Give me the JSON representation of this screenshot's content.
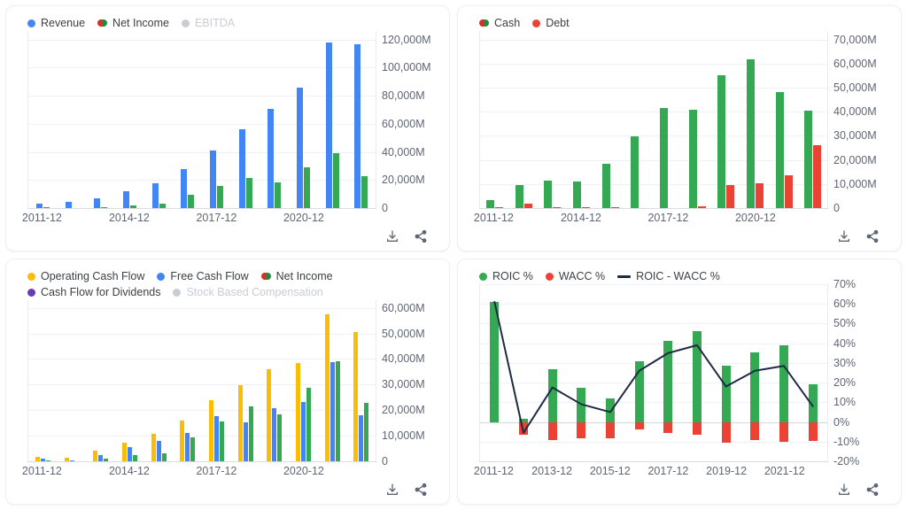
{
  "colors": {
    "revenue_blue": "#4285F4",
    "net_income_green": "#34A853",
    "cash_green": "#34A853",
    "debt_red": "#EA4335",
    "operating_cash_flow_yellow": "#FBBC04",
    "free_cash_flow_blue": "#4285F4",
    "dividends_purple": "#673AB7",
    "disabled_gray": "#C8CDD4",
    "roic_wacc_line": "#1F2A44"
  },
  "panels": [
    {
      "id": "income-statement",
      "legend": [
        {
          "label": "Revenue",
          "marker": "dot",
          "color": "#4285F4",
          "disabled": false
        },
        {
          "label": "Net Income",
          "marker": "dual-dot",
          "color": "#34A853",
          "disabled": false
        },
        {
          "label": "EBITDA",
          "marker": "dot",
          "color": "#C8CDD4",
          "disabled": true
        }
      ],
      "actions": [
        {
          "label": "Download",
          "icon": "download-icon"
        },
        {
          "label": "Share",
          "icon": "share-icon"
        }
      ]
    },
    {
      "id": "balance-sheet",
      "legend": [
        {
          "label": "Cash",
          "marker": "dual-dot",
          "color": "#34A853",
          "disabled": false
        },
        {
          "label": "Debt",
          "marker": "dot",
          "color": "#EA4335",
          "disabled": false
        }
      ],
      "actions": [
        {
          "label": "Download",
          "icon": "download-icon"
        },
        {
          "label": "Share",
          "icon": "share-icon"
        }
      ]
    },
    {
      "id": "cash-flow",
      "legend": [
        {
          "label": "Operating Cash Flow",
          "marker": "dot",
          "color": "#FBBC04",
          "disabled": false
        },
        {
          "label": "Free Cash Flow",
          "marker": "dot",
          "color": "#4285F4",
          "disabled": false
        },
        {
          "label": "Net Income",
          "marker": "dual-dot",
          "color": "#34A853",
          "disabled": false
        },
        {
          "label": "Cash Flow for Dividends",
          "marker": "dot",
          "color": "#673AB7",
          "disabled": false
        },
        {
          "label": "Stock Based Compensation",
          "marker": "dot",
          "color": "#C8CDD4",
          "disabled": true
        }
      ],
      "actions": [
        {
          "label": "Download",
          "icon": "download-icon"
        },
        {
          "label": "Share",
          "icon": "share-icon"
        }
      ]
    },
    {
      "id": "roic-wacc",
      "legend": [
        {
          "label": "ROIC %",
          "marker": "dot",
          "color": "#34A853",
          "disabled": false
        },
        {
          "label": "WACC %",
          "marker": "dot",
          "color": "#EA4335",
          "disabled": false
        },
        {
          "label": "ROIC - WACC %",
          "marker": "line",
          "color": "#1F2A44",
          "disabled": false
        }
      ],
      "actions": [
        {
          "label": "Download",
          "icon": "download-icon"
        },
        {
          "label": "Share",
          "icon": "share-icon"
        }
      ]
    }
  ],
  "chart_data": [
    {
      "type": "bar",
      "id": "income-statement",
      "title": "",
      "xlabel": "",
      "ylabel": "",
      "grid": true,
      "legend_position": "top-left",
      "categories": [
        "2011-12",
        "2012-12",
        "2013-12",
        "2014-12",
        "2015-12",
        "2016-12",
        "2017-12",
        "2018-12",
        "2019-12",
        "2020-12",
        "2021-12",
        "2022-12"
      ],
      "x_tick_labels": [
        "2011-12",
        "2014-12",
        "2017-12",
        "2020-12"
      ],
      "x_tick_indices": [
        0,
        3,
        6,
        9
      ],
      "y_ticks": [
        0,
        20000,
        40000,
        60000,
        80000,
        100000,
        120000
      ],
      "y_tick_labels": [
        "0",
        "20,000M",
        "40,000M",
        "60,000M",
        "80,000M",
        "100,000M",
        "120,000M"
      ],
      "ylim": [
        0,
        126000
      ],
      "series": [
        {
          "name": "Revenue",
          "color": "#4285F4",
          "values": [
            3300,
            4200,
            6900,
            11800,
            17900,
            27600,
            40700,
            55800,
            70700,
            85900,
            117900,
            116600
          ]
        },
        {
          "name": "Net Income",
          "color": "#34A853",
          "values": [
            400,
            300,
            800,
            2200,
            3000,
            9500,
            15900,
            21300,
            18500,
            29100,
            39200,
            22700
          ]
        },
        {
          "name": "EBITDA",
          "color": "#C8CDD4",
          "values": [],
          "hidden": true
        }
      ]
    },
    {
      "type": "bar",
      "id": "balance-sheet",
      "title": "",
      "xlabel": "",
      "ylabel": "",
      "grid": true,
      "legend_position": "top-left",
      "categories": [
        "2011-12",
        "2012-12",
        "2013-12",
        "2014-12",
        "2015-12",
        "2016-12",
        "2017-12",
        "2018-12",
        "2019-12",
        "2020-12",
        "2021-12",
        "2022-12"
      ],
      "x_tick_labels": [
        "2011-12",
        "2014-12",
        "2017-12",
        "2020-12"
      ],
      "x_tick_indices": [
        0,
        3,
        6,
        9
      ],
      "y_ticks": [
        0,
        10000,
        20000,
        30000,
        40000,
        50000,
        60000,
        70000
      ],
      "y_tick_labels": [
        "0",
        "10,000M",
        "20,000M",
        "30,000M",
        "40,000M",
        "50,000M",
        "60,000M",
        "70,000M"
      ],
      "ylim": [
        0,
        73500
      ],
      "series": [
        {
          "name": "Cash",
          "color": "#34A853",
          "values": [
            3400,
            9600,
            11300,
            11000,
            18500,
            29700,
            41400,
            40800,
            55200,
            61800,
            48200,
            40400
          ]
        },
        {
          "name": "Debt",
          "color": "#EA4335",
          "values": [
            500,
            1700,
            400,
            300,
            300,
            0,
            0,
            600,
            9700,
            10300,
            13700,
            26000
          ]
        }
      ]
    },
    {
      "type": "bar",
      "id": "cash-flow",
      "title": "",
      "xlabel": "",
      "ylabel": "",
      "grid": true,
      "legend_position": "top-left",
      "categories": [
        "2011-12",
        "2012-12",
        "2013-12",
        "2014-12",
        "2015-12",
        "2016-12",
        "2017-12",
        "2018-12",
        "2019-12",
        "2020-12",
        "2021-12",
        "2022-12"
      ],
      "x_tick_labels": [
        "2011-12",
        "2014-12",
        "2017-12",
        "2020-12"
      ],
      "x_tick_indices": [
        0,
        3,
        6,
        9
      ],
      "y_ticks": [
        0,
        10000,
        20000,
        30000,
        40000,
        50000,
        60000
      ],
      "y_tick_labels": [
        "0",
        "10,000M",
        "20,000M",
        "30,000M",
        "40,000M",
        "50,000M",
        "60,000M"
      ],
      "ylim": [
        0,
        63000
      ],
      "series": [
        {
          "name": "Operating Cash Flow",
          "color": "#FBBC04",
          "values": [
            1600,
            1500,
            4200,
            7300,
            10700,
            16100,
            24000,
            29900,
            36000,
            38300,
            57400,
            50600
          ]
        },
        {
          "name": "Free Cash Flow",
          "color": "#4285F4",
          "values": [
            900,
            400,
            2600,
            5600,
            8100,
            11200,
            17600,
            15400,
            20800,
            23100,
            38800,
            18100
          ]
        },
        {
          "name": "Net Income",
          "color": "#34A853",
          "values": [
            300,
            100,
            1200,
            2400,
            3100,
            9500,
            15500,
            21500,
            18500,
            28700,
            39200,
            22800
          ]
        },
        {
          "name": "Cash Flow for Dividends",
          "color": "#673AB7",
          "values": [],
          "hidden": true
        },
        {
          "name": "Stock Based Compensation",
          "color": "#C8CDD4",
          "values": [],
          "hidden": true
        }
      ]
    },
    {
      "type": "bar",
      "id": "roic-wacc",
      "title": "",
      "xlabel": "",
      "ylabel": "",
      "grid": true,
      "legend_position": "top-left",
      "categories": [
        "2011-12",
        "2012-12",
        "2013-12",
        "2014-12",
        "2015-12",
        "2016-12",
        "2017-12",
        "2018-12",
        "2019-12",
        "2020-12",
        "2021-12",
        "2022-12"
      ],
      "x_tick_labels": [
        "2011-12",
        "2013-12",
        "2015-12",
        "2017-12",
        "2019-12",
        "2021-12"
      ],
      "x_tick_indices": [
        0,
        2,
        4,
        6,
        8,
        10
      ],
      "y_ticks": [
        -20,
        -10,
        0,
        10,
        20,
        30,
        40,
        50,
        60,
        70
      ],
      "y_tick_labels": [
        "-20%",
        "-10%",
        "0%",
        "10%",
        "20%",
        "30%",
        "40%",
        "50%",
        "60%",
        "70%"
      ],
      "ylim": [
        -20,
        70
      ],
      "series": [
        {
          "name": "ROIC %",
          "color": "#34A853",
          "values": [
            61,
            1.5,
            27,
            17.5,
            12,
            31,
            41,
            46,
            28.5,
            35.5,
            39,
            19
          ]
        },
        {
          "name": "WACC %",
          "color": "#EA4335",
          "values": [
            0,
            -6.5,
            -9,
            -8.5,
            -8.5,
            -4,
            -5.5,
            -6.5,
            -10.5,
            -9,
            -10,
            -9.5
          ]
        },
        {
          "name": "ROIC - WACC %",
          "color": "#1F2A44",
          "type": "line",
          "values": [
            61,
            -5.5,
            17.5,
            9,
            5,
            26,
            35,
            39,
            18,
            26,
            28.5,
            8
          ]
        }
      ]
    }
  ]
}
